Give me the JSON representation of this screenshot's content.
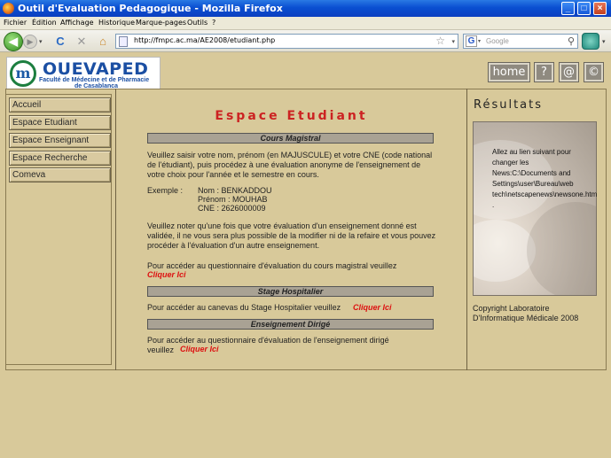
{
  "window": {
    "title": "Outil d'Evaluation Pedagogique - Mozilla Firefox",
    "minimize": "_",
    "maximize": "□",
    "close": "×"
  },
  "menu": [
    "Fichier",
    "Édition",
    "Affichage",
    "Historique",
    "Marque-pages",
    "Outils",
    "?"
  ],
  "nav": {
    "back": "◀",
    "forward": "▶",
    "dropdown": "▾",
    "reload": "C",
    "stop": "✕",
    "home": "⌂",
    "url": "http://fmpc.ac.ma/AE2008/etudiant.php",
    "star": "☆",
    "search_engine": "G",
    "search_placeholder": "Google",
    "search_icon": "⚲"
  },
  "logo": {
    "mark": "m",
    "name": "OUEVAPED",
    "subtitle1": "Faculté de Médecine et de Pharmacie",
    "subtitle2": "de Casablanca"
  },
  "top_buttons": [
    "home",
    "?",
    "@",
    "©"
  ],
  "sidebar": {
    "items": [
      {
        "label": "Accueil"
      },
      {
        "label": "Espace Etudiant"
      },
      {
        "label": "Espace Enseignant"
      },
      {
        "label": "Espace Recherche"
      },
      {
        "label": "Comeva"
      }
    ]
  },
  "main": {
    "title": "Espace Etudiant",
    "cours": {
      "heading": "Cours Magistral",
      "intro": "Veuillez saisir votre nom, prénom (en MAJUSCULE) et votre CNE (code national de l'étudiant), puis procédez à une évaluation anonyme de l'enseignement de votre choix pour l'année et le semestre en cours.",
      "example_label": "Exemple :",
      "example_nom": "Nom :   BENKADDOU",
      "example_prenom": "Prénom : MOUHAB",
      "example_cne": "CNE   : 2626000009",
      "note": "Veuillez noter qu'une fois que votre évaluation d'un enseignement donné est validée, il ne vous sera plus possible de la modifier ni de la refaire et vous pouvez procéder à l'évaluation d'un autre enseignement.",
      "access": "Pour accéder au questionnaire d'évaluation du cours magistral veuillez",
      "link": "Cliquer Ici"
    },
    "stage": {
      "heading": "Stage Hospitalier",
      "access": "Pour accéder au canevas du Stage Hospitalier veuillez",
      "link": "Cliquer Ici"
    },
    "dirige": {
      "heading": "Enseignement Dirigé",
      "access": "Pour accéder au questionnaire d'évaluation de l'enseignement dirigé veuillez",
      "link": "Cliquer Ici"
    }
  },
  "results": {
    "title": "Résultats",
    "text": "Allez au lien suivant pour changer les News:C:\\Documents and Settings\\user\\Bureau\\web tech\\netscapenews\\newsone.htm .",
    "copyright": "Copyright Laboratoire D'Informatique Médicale 2008"
  }
}
